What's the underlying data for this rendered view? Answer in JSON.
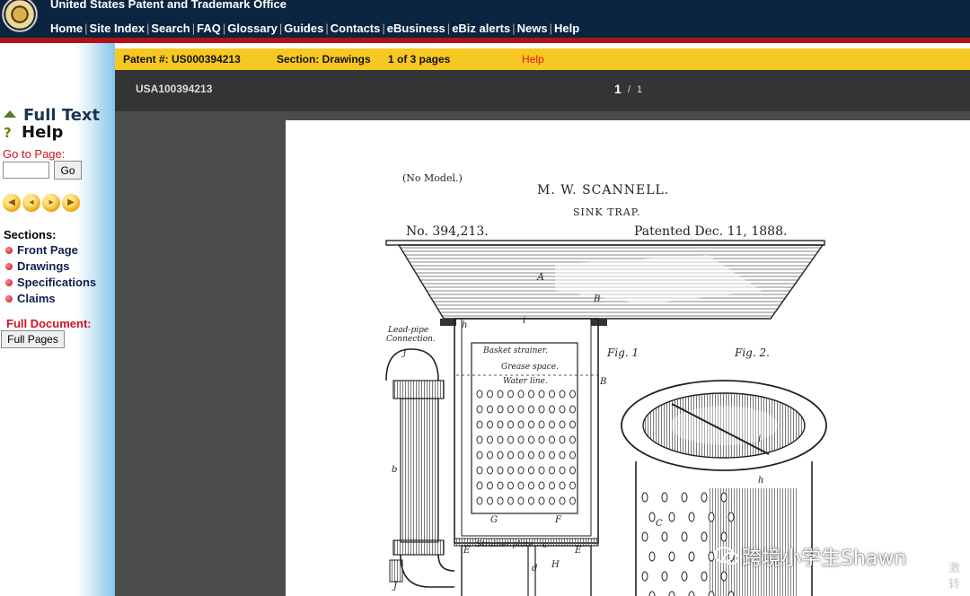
{
  "header": {
    "org_name": "United States Patent and Trademark Office",
    "nav": [
      "Home",
      "Site Index",
      "Search",
      "FAQ",
      "Glossary",
      "Guides",
      "Contacts",
      "eBusiness",
      "eBiz alerts",
      "News",
      "Help"
    ]
  },
  "sidebar": {
    "full_text": "Full Text",
    "help": "Help",
    "goto_label": "Go to Page:",
    "goto_value": "",
    "go_button": "Go",
    "nav_arrows": [
      "first-page-icon",
      "previous-page-icon",
      "next-page-icon",
      "last-page-icon"
    ],
    "sections_label": "Sections:",
    "sections": [
      "Front Page",
      "Drawings",
      "Specifications",
      "Claims"
    ],
    "full_document_label": "Full Document:",
    "full_pages_button": "Full Pages"
  },
  "patent_bar": {
    "patent_number": "Patent #: US000394213",
    "section": "Section: Drawings",
    "pages": "1 of 3 pages",
    "help": "Help"
  },
  "viewer": {
    "document_id": "USA100394213",
    "current_page": "1",
    "page_separator": "/",
    "total_pages": "1"
  },
  "drawing": {
    "no_model": "(No Model.)",
    "inventor": "M. W. SCANNELL.",
    "title": "SINK TRAP.",
    "patent_no": "No. 394,213.",
    "patented": "Patented Dec. 11, 1888.",
    "fig1": "Fig. 1",
    "fig2": "Fig. 2.",
    "lead_pipe_line1": "Lead-pipe",
    "lead_pipe_line2": "Connection.",
    "basket_strainer": "Basket strainer.",
    "grease_space": "Grease space.",
    "water_line": "Water line.",
    "strainer_plate": "Strainer plate.",
    "letters": {
      "A": "A",
      "B": "B",
      "B2": "B",
      "h": "h",
      "i": "i",
      "j": "j",
      "b": "b",
      "G": "G",
      "F": "F",
      "E": "E",
      "E2": "E",
      "d": "d",
      "H": "H",
      "c": "c",
      "J": "J",
      "C": "C",
      "h2": "h",
      "i2": "i"
    }
  },
  "watermark": {
    "text": "跨境小学生Shawn",
    "side_line1": "激",
    "side_line2": "转"
  },
  "colors": {
    "header_bg": "#0b2540",
    "header_rule": "#b01218",
    "patent_bar": "#f8c822",
    "viewer_bg": "#4a4c4e",
    "viewer_toolbar": "#323436",
    "link_red": "#d0121a"
  }
}
